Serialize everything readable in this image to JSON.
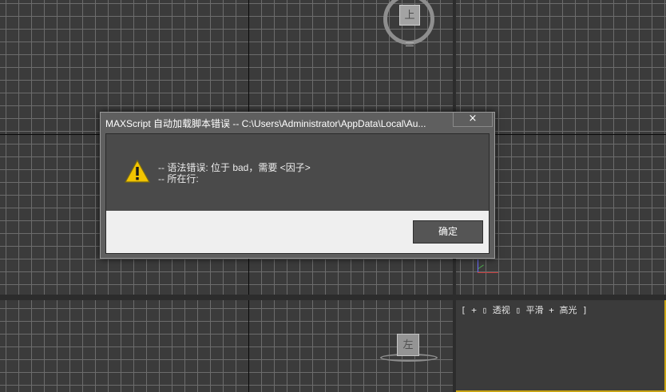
{
  "viewports": {
    "active_label": "[ + ▯ 透视 ▯ 平滑 + 高光 ]",
    "top_viewcube_face": "上",
    "bottom_viewcube_face": "左"
  },
  "dialog": {
    "title": "MAXScript 自动加载脚本错误 -- C:\\Users\\Administrator\\AppData\\Local\\Au...",
    "close_icon": "×",
    "warning_icon": "warning-triangle-icon",
    "message_line1": "-- 语法错误: 位于 bad，需要 <因子>",
    "message_line2": "-- 所在行:",
    "ok_label": "确定"
  },
  "colors": {
    "viewport_bg": "#3b3b3b",
    "grid_line": "#6c6c6c",
    "active_viewport_border": "#c8a414",
    "dialog_message_bg": "#4a4a4a",
    "dialog_button_bg": "#efefef",
    "warning_yellow": "#f2c400"
  }
}
